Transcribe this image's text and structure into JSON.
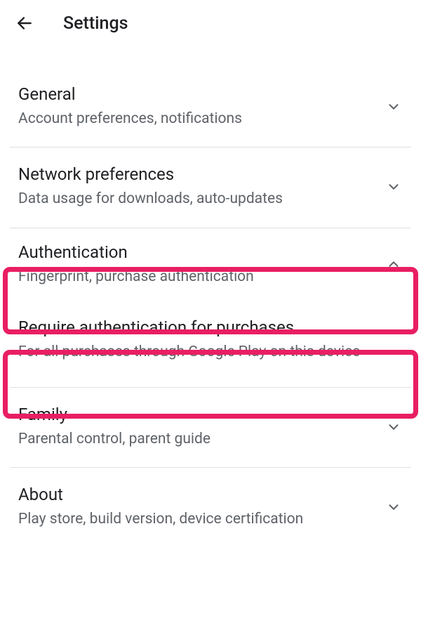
{
  "header": {
    "title": "Settings"
  },
  "sections": {
    "general": {
      "title": "General",
      "subtitle": "Account preferences, notifications"
    },
    "network": {
      "title": "Network preferences",
      "subtitle": "Data usage for downloads, auto-updates"
    },
    "authentication": {
      "title": "Authentication",
      "subtitle": "Fingerprint, purchase authentication"
    },
    "require_auth": {
      "title": "Require authentication for purchases",
      "subtitle": "For all purchases through Google Play on this device"
    },
    "family": {
      "title": "Family",
      "subtitle": "Parental control, parent guide"
    },
    "about": {
      "title": "About",
      "subtitle": "Play store, build version, device certification"
    }
  }
}
